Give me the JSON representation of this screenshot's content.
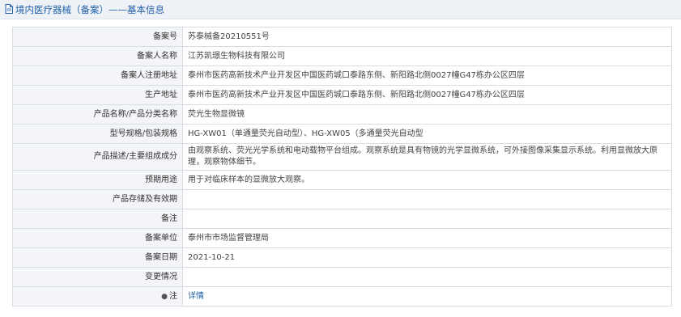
{
  "header": {
    "title": "境内医疗器械（备案）——基本信息",
    "icon": "document-icon"
  },
  "rows": [
    {
      "label": "备案号",
      "value": "苏泰械备20210551号"
    },
    {
      "label": "备案人名称",
      "value": "江苏凯璟生物科技有限公司"
    },
    {
      "label": "备案人注册地址",
      "value": "泰州市医药高新技术产业开发区中国医药城口泰路东侧、新阳路北侧0027幢G47栋办公区四层"
    },
    {
      "label": "生产地址",
      "value": "泰州市医药高新技术产业开发区中国医药城口泰路东侧、新阳路北侧0027幢G47栋办公区四层"
    },
    {
      "label": "产品名称/产品分类名称",
      "value": "荧光生物显微镜"
    },
    {
      "label": "型号规格/包装规格",
      "value": "HG-XW01（单通量荧光自动型）、HG-XW05（多通量荧光自动型"
    },
    {
      "label": "产品描述/主要组成成分",
      "value": "由观察系统、荧光光学系统和电动载物平台组成。观察系统是具有物镜的光学显微系统，可外接图像采集显示系统。利用显微放大原理，观察物体细节。"
    },
    {
      "label": "预期用途",
      "value": "用于对临床样本的显微放大观察。"
    },
    {
      "label": "产品存储及有效期",
      "value": ""
    },
    {
      "label": "备注",
      "value": ""
    },
    {
      "label": "备案单位",
      "value": "泰州市市场监督管理局"
    },
    {
      "label": "备案日期",
      "value": "2021-10-21"
    },
    {
      "label": "变更情况",
      "value": ""
    },
    {
      "label": "注",
      "value": "详情",
      "icon": "pin-icon"
    }
  ]
}
